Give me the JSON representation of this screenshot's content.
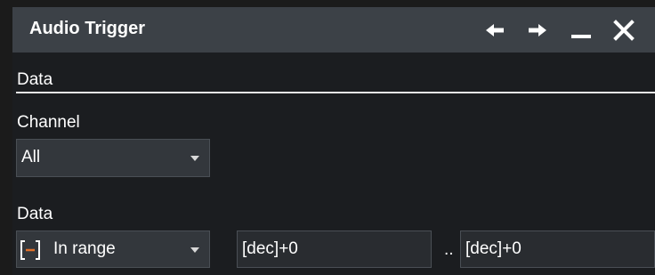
{
  "dialog": {
    "title": "Audio Trigger",
    "actions": [
      {
        "icon": "arrow-left-icon"
      },
      {
        "icon": "arrow-right-icon"
      },
      {
        "icon": "minimize-icon"
      },
      {
        "icon": "close-icon"
      }
    ]
  },
  "section": {
    "title": "Data"
  },
  "channel": {
    "label": "Channel",
    "selected": "All"
  },
  "data": {
    "label": "Data",
    "condition_icon": "in-range-bracket-icon",
    "condition": "In range",
    "min_value": "[dec]+0",
    "range_separator": "..",
    "max_value": "[dec]+0"
  },
  "colors": {
    "titlebar": "#3c4147",
    "panel": "#1b1d20",
    "dropdown": "#33373c",
    "input": "#292c30",
    "accent": "#e0702a"
  }
}
